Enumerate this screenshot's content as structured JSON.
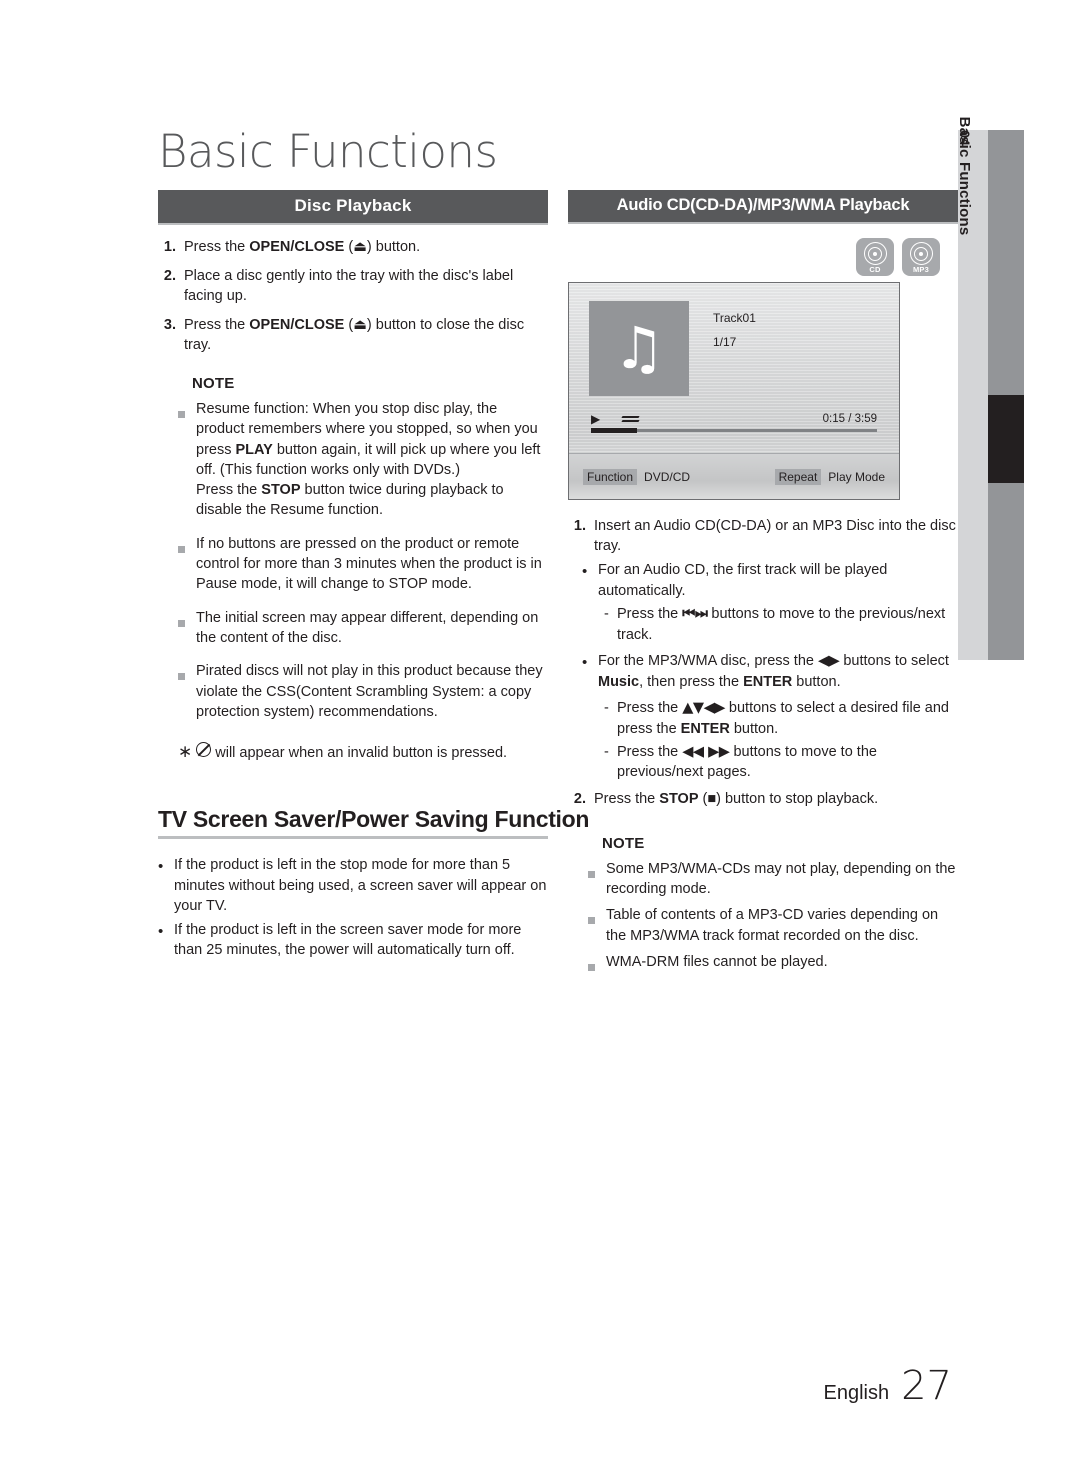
{
  "page": {
    "main_title": "Basic Functions",
    "chapter_number": "04",
    "chapter_name": "Basic Functions",
    "footer_language": "English",
    "footer_page": "27"
  },
  "left_column": {
    "section_title": "Disc Playback",
    "steps": [
      {
        "num": "1.",
        "text_before": "Press the ",
        "bold": "OPEN/CLOSE",
        "text_after": " (⏏) button."
      },
      {
        "num": "2.",
        "text_before": "Place a disc gently into the tray with the disc's label facing up.",
        "bold": "",
        "text_after": ""
      },
      {
        "num": "3.",
        "text_before": "Press the ",
        "bold": "OPEN/CLOSE",
        "text_after": " (⏏) button to close the disc tray."
      }
    ],
    "note_title": "NOTE",
    "notes": [
      "Resume function: When you stop disc play, the product remembers where you stopped, so when you press PLAY button again, it will pick up where you left off. (This function works only with DVDs.) Press the STOP button twice during playback to disable the Resume function.",
      "If no buttons are pressed on the product or remote control for more than 3 minutes when the product is in Pause mode, it will change to STOP mode.",
      "The initial screen may appear different, depending on the content of the disc.",
      "Pirated discs will not play in this product because they violate the CSS(Content Scrambling System: a copy protection system) recommendations."
    ],
    "note_bold_terms": [
      "PLAY",
      "STOP"
    ],
    "star_note": "will appear when an invalid button is pressed.",
    "star_symbol": "∗",
    "subsection_title": "TV Screen Saver/Power Saving Function",
    "subsection_bullets": [
      "If the product is left in the stop mode for more than 5 minutes without being used, a screen saver will appear on your TV.",
      "If the product is left in the screen saver mode for more than 25 minutes, the power will automatically turn off."
    ]
  },
  "right_column": {
    "section_title": "Audio CD(CD-DA)/MP3/WMA Playback",
    "media_icons": [
      {
        "name": "cd-disc-icon",
        "label": "CD"
      },
      {
        "name": "mp3-disc-icon",
        "label": "MP3"
      }
    ],
    "osd": {
      "track_title": "Track01",
      "track_index": "1/17",
      "elapsed": "0:15",
      "separator": "/",
      "total": "3:59",
      "function_chip": "Function",
      "function_value": "DVD/CD",
      "repeat_chip": "Repeat",
      "repeat_value": "Play Mode",
      "progress_percent": 16
    },
    "steps": [
      {
        "num": "1.",
        "text": "Insert an Audio CD(CD-DA) or an MP3 Disc into the disc tray."
      },
      {
        "num": "2.",
        "text_before": "Press the ",
        "bold": "STOP",
        "text_after": " (■) button to stop playback."
      }
    ],
    "bullets": [
      {
        "text": "For an Audio CD, the first track will be played automatically.",
        "dashes": [
          {
            "before": "Press the ",
            "glyph": "⏮⏭",
            "after": " buttons to move to the previous/next track."
          }
        ]
      },
      {
        "before": "For the MP3/WMA disc, press the ",
        "glyph": "◀▶",
        "middle": " buttons to select ",
        "bold": "Music",
        "after_bold": ", then press the ",
        "bold2": "ENTER",
        "after": " button.",
        "dashes": [
          {
            "before": "Press the ",
            "glyph": "▲▼◀▶",
            "after": " buttons to select  a desired file and press the ",
            "bold": "ENTER",
            "after2": " button."
          },
          {
            "before": "Press the ",
            "glyph": "◀◀ ▶▶",
            "after": " buttons to move to the previous/next pages."
          }
        ]
      }
    ],
    "note_title": "NOTE",
    "notes": [
      "Some MP3/WMA-CDs may not play, depending on the recording mode.",
      "Table of contents of a MP3-CD varies depending on the MP3/WMA track format recorded on the disc.",
      "WMA-DRM files cannot be played."
    ]
  },
  "colors": {
    "section_bar_bg": "#58595b",
    "side_tab_bg": "#d4d5d7",
    "side_tab_bar": "#939598",
    "side_tab_marker": "#231f20",
    "note_square": "#a7a9ac",
    "text": "#231f20"
  }
}
